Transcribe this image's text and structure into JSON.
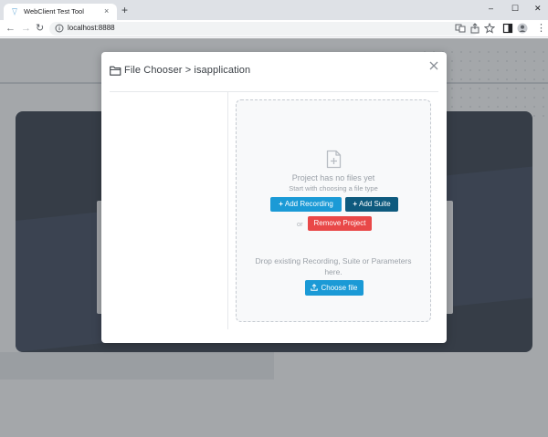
{
  "browser": {
    "tab_title": "WebClient Test Tool",
    "tab_close": "×",
    "new_tab": "+",
    "url": "localhost:8888",
    "nav": {
      "back": "←",
      "forward": "→",
      "reload": "↻"
    },
    "window_controls": {
      "minimize": "–",
      "maximize": "☐",
      "close": "✕"
    },
    "menu": "⋮"
  },
  "modal": {
    "title": "File Chooser > isapplication",
    "dropzone": {
      "empty_title": "Project has no files yet",
      "empty_subtitle": "Start with choosing a file type",
      "add_recording_plus": "+",
      "add_recording_label": "Add Recording",
      "add_suite_plus": "+",
      "add_suite_label": "Add Suite",
      "or_text": "or",
      "remove_project_label": "Remove Project",
      "drop_text": "Drop existing Recording, Suite or Parameters here.",
      "choose_file_label": "Choose file"
    }
  },
  "colors": {
    "primary": "#1b9ad6",
    "secondary": "#0e5a7e",
    "danger": "#e94848"
  },
  "icons": {
    "folder": "folder-icon",
    "file_plus": "file-plus-icon",
    "close": "close-icon",
    "upload": "upload-icon"
  }
}
